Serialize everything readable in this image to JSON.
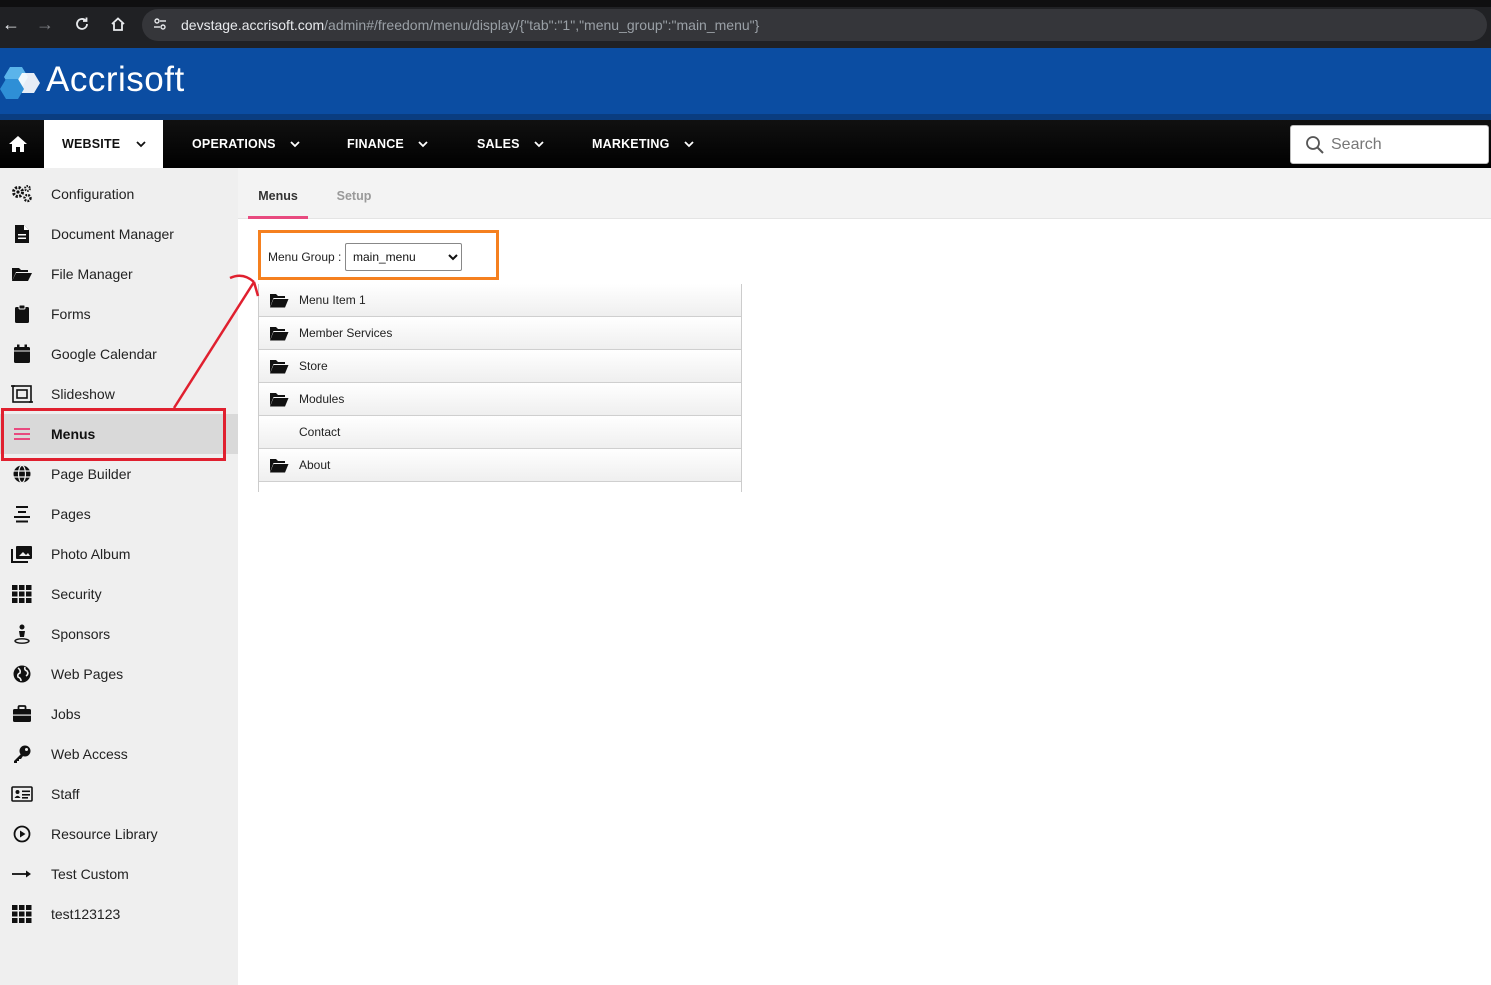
{
  "browser": {
    "url_host": "devstage.accrisoft.com",
    "url_path": "/admin#/freedom/menu/display/{\"tab\":\"1\",\"menu_group\":\"main_menu\"}",
    "back_icon": "arrow-left-icon",
    "forward_icon": "arrow-right-icon",
    "reload_icon": "reload-icon",
    "home_icon": "home-icon"
  },
  "brand": {
    "name": "Accrisoft",
    "color": "#0b4da2"
  },
  "mainnav": {
    "items": [
      {
        "label": "WEBSITE",
        "active": true
      },
      {
        "label": "OPERATIONS"
      },
      {
        "label": "FINANCE"
      },
      {
        "label": "SALES"
      },
      {
        "label": "MARKETING"
      }
    ],
    "search_placeholder": "Search"
  },
  "sidebar": {
    "items": [
      {
        "label": "Configuration",
        "icon": "gears-icon"
      },
      {
        "label": "Document Manager",
        "icon": "document-icon"
      },
      {
        "label": "File Manager",
        "icon": "folder-open-icon"
      },
      {
        "label": "Forms",
        "icon": "clipboard-icon"
      },
      {
        "label": "Google Calendar",
        "icon": "calendar-icon"
      },
      {
        "label": "Slideshow",
        "icon": "slideshow-icon"
      },
      {
        "label": "Menus",
        "icon": "hamburger-icon",
        "active": true
      },
      {
        "label": "Page Builder",
        "icon": "globe-icon"
      },
      {
        "label": "Pages",
        "icon": "align-center-icon"
      },
      {
        "label": "Photo Album",
        "icon": "photo-album-icon"
      },
      {
        "label": "Security",
        "icon": "grid-icon"
      },
      {
        "label": "Sponsors",
        "icon": "person-pin-icon"
      },
      {
        "label": "Web Pages",
        "icon": "globe-solid-icon"
      },
      {
        "label": "Jobs",
        "icon": "briefcase-icon"
      },
      {
        "label": "Web Access",
        "icon": "key-icon"
      },
      {
        "label": "Staff",
        "icon": "id-card-icon"
      },
      {
        "label": "Resource Library",
        "icon": "play-circle-icon"
      },
      {
        "label": "Test Custom",
        "icon": "arrow-right-long-icon"
      },
      {
        "label": "test123123",
        "icon": "grid-icon"
      }
    ]
  },
  "tabs": [
    {
      "label": "Menus",
      "active": true
    },
    {
      "label": "Setup"
    }
  ],
  "menu_group": {
    "label": "Menu Group :",
    "selected": "main_menu"
  },
  "tree": {
    "items": [
      {
        "label": "Menu Item 1",
        "folder": true
      },
      {
        "label": "Member Services",
        "folder": true
      },
      {
        "label": "Store",
        "folder": true
      },
      {
        "label": "Modules",
        "folder": true
      },
      {
        "label": "Contact",
        "folder": false
      },
      {
        "label": "About",
        "folder": true
      }
    ]
  },
  "colors": {
    "accent_pink": "#e84a7f",
    "annotation_red": "#e0202f",
    "annotation_orange": "#f5801f"
  }
}
